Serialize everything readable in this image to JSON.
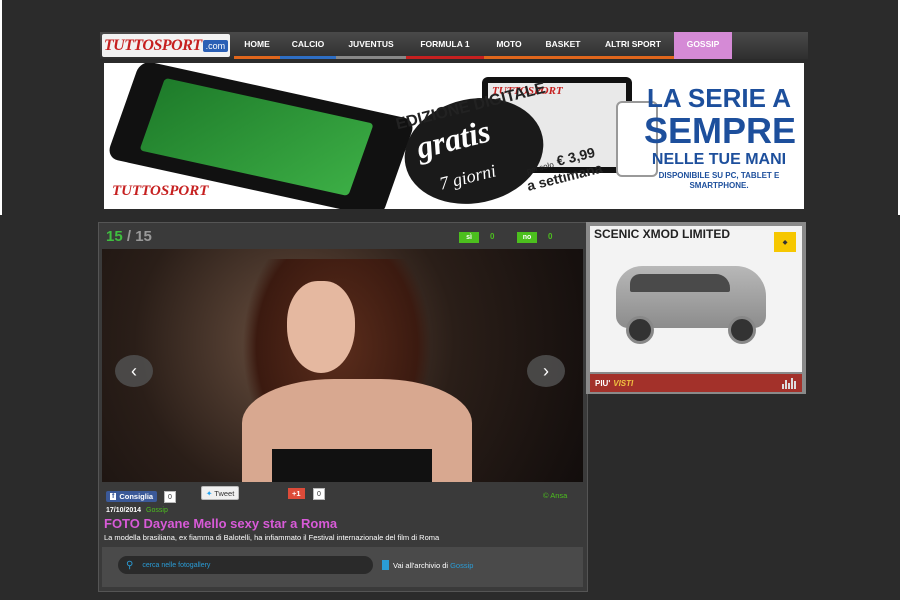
{
  "site": {
    "logo_text": "TUTTOSPORT",
    "logo_suffix": ".com"
  },
  "nav": [
    {
      "label": "HOME",
      "color": "#e0661c"
    },
    {
      "label": "CALCIO",
      "color": "#2e6ec4"
    },
    {
      "label": "JUVENTUS",
      "color": "#888888"
    },
    {
      "label": "FORMULA 1",
      "color": "#c62020"
    },
    {
      "label": "MOTO",
      "color": "#e0661c"
    },
    {
      "label": "BASKET",
      "color": "#e0661c"
    },
    {
      "label": "ALTRI SPORT",
      "color": "#e0661c"
    },
    {
      "label": "GOSSIP",
      "color": "#d58ad6",
      "active": true
    }
  ],
  "banner": {
    "logo": "TUTTOSPORT",
    "edition": "EDIZIONE DIGITALE",
    "gratis": "gratis",
    "days": "7 giorni",
    "price_prefix": "poi solo",
    "price": "€ 3,99",
    "price_suffix": "a settimana",
    "tablet_header": "TUTTOSPORT",
    "headline_1": "LA SERIE A",
    "headline_2": "SEMPRE",
    "headline_3": "NELLE TUE MANI",
    "availability": "DISPONIBILE SU PC, TABLET E SMARTPHONE."
  },
  "gallery": {
    "current": "15",
    "separator": " / ",
    "total": "15",
    "vote_yes_label": "sì",
    "vote_yes_count": "0",
    "vote_no_label": "no",
    "vote_no_count": "0",
    "prev_arrow": "‹",
    "next_arrow": "›",
    "facebook_label": "Consiglia",
    "facebook_count": "0",
    "tweet_label": "Tweet",
    "gplus_label": "+1",
    "gplus_count": "0",
    "credit": "© Ansa",
    "date": "17/10/2014",
    "category": "Gossip",
    "title": "FOTO Dayane Mello sexy star a Roma",
    "description": "La modella brasiliana, ex fiamma di Balotelli, ha infiammato il Festival internazionale del film di Roma",
    "search_placeholder": "cerca nelle fotogallery",
    "archive_text": "Vai all'archivio di",
    "archive_link": "Gossip"
  },
  "ad": {
    "title": "SCENIC XMOD LIMITED",
    "brand": "RENAULT",
    "most_viewed_prefix": "PIU'",
    "most_viewed_suffix": "VISTI"
  }
}
